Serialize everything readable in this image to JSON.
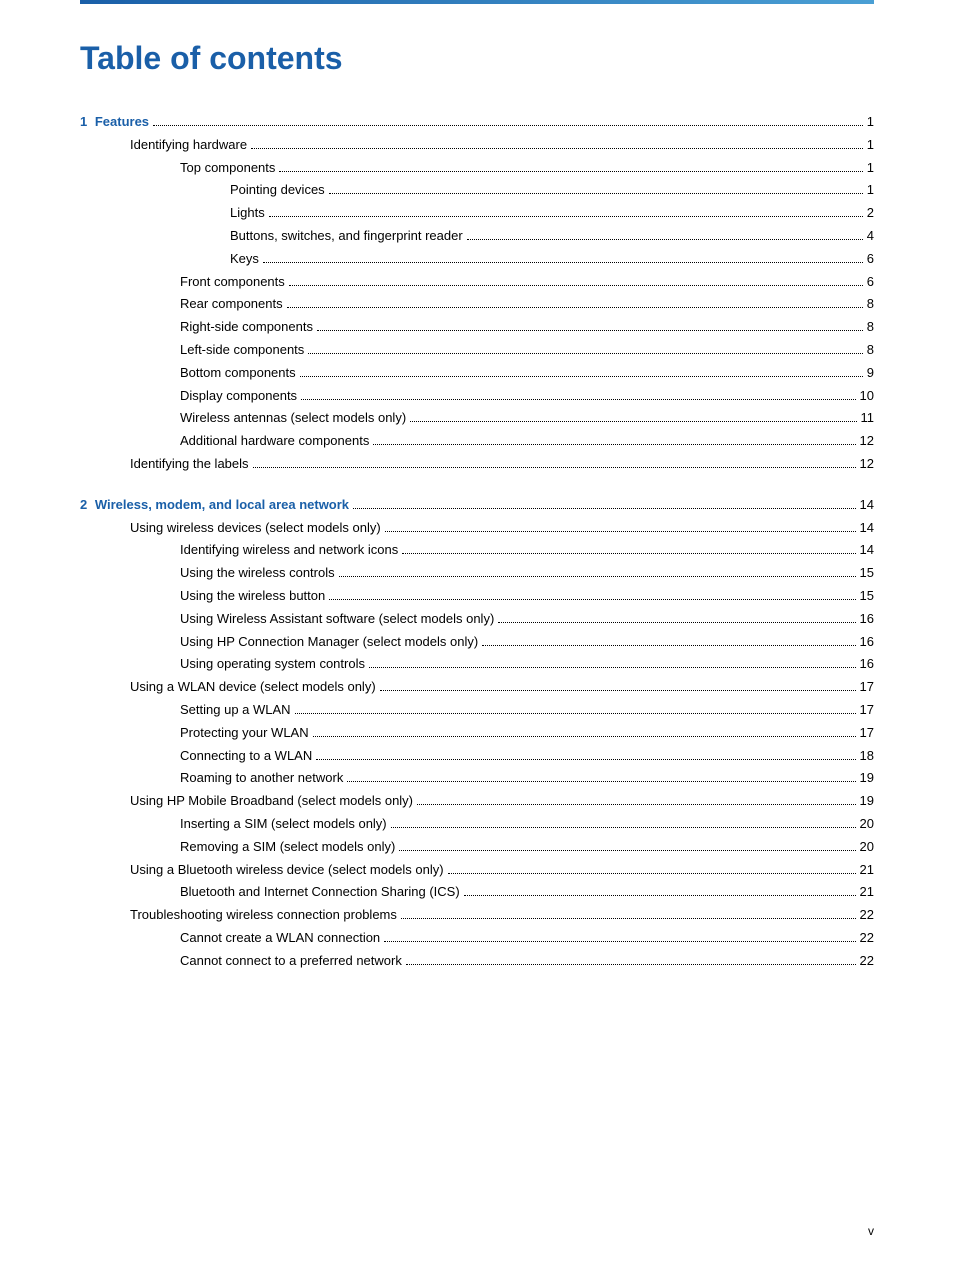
{
  "header": {
    "title": "Table of contents"
  },
  "footer": {
    "page": "v"
  },
  "toc": [
    {
      "level": 1,
      "number": "1",
      "text": "Features",
      "page": "1",
      "children": [
        {
          "level": 2,
          "text": "Identifying hardware",
          "page": "1",
          "children": [
            {
              "level": 3,
              "text": "Top components",
              "page": "1",
              "children": [
                {
                  "level": 4,
                  "text": "Pointing devices",
                  "page": "1"
                },
                {
                  "level": 4,
                  "text": "Lights",
                  "page": "2"
                },
                {
                  "level": 4,
                  "text": "Buttons, switches, and fingerprint reader",
                  "page": "4"
                },
                {
                  "level": 4,
                  "text": "Keys",
                  "page": "6"
                }
              ]
            },
            {
              "level": 3,
              "text": "Front components",
              "page": "6",
              "children": []
            },
            {
              "level": 3,
              "text": "Rear components",
              "page": "8",
              "children": []
            },
            {
              "level": 3,
              "text": "Right-side components",
              "page": "8",
              "children": []
            },
            {
              "level": 3,
              "text": "Left-side components",
              "page": "8",
              "children": []
            },
            {
              "level": 3,
              "text": "Bottom components",
              "page": "9",
              "children": []
            },
            {
              "level": 3,
              "text": "Display components",
              "page": "10",
              "children": []
            },
            {
              "level": 3,
              "text": "Wireless antennas (select models only)",
              "page": "11",
              "children": []
            },
            {
              "level": 3,
              "text": "Additional hardware components",
              "page": "12",
              "children": []
            }
          ]
        },
        {
          "level": 2,
          "text": "Identifying the labels",
          "page": "12",
          "children": []
        }
      ]
    },
    {
      "level": 1,
      "number": "2",
      "text": "Wireless, modem, and local area network",
      "page": "14",
      "children": [
        {
          "level": 2,
          "text": "Using wireless devices (select models only)",
          "page": "14",
          "children": [
            {
              "level": 3,
              "text": "Identifying wireless and network icons",
              "page": "14",
              "children": []
            },
            {
              "level": 3,
              "text": "Using the wireless controls",
              "page": "15",
              "children": []
            },
            {
              "level": 3,
              "text": "Using the wireless button",
              "page": "15",
              "children": []
            },
            {
              "level": 3,
              "text": "Using Wireless Assistant software (select models only)",
              "page": "16",
              "children": []
            },
            {
              "level": 3,
              "text": "Using HP Connection Manager (select models only)",
              "page": "16",
              "children": []
            },
            {
              "level": 3,
              "text": "Using operating system controls",
              "page": "16",
              "children": []
            }
          ]
        },
        {
          "level": 2,
          "text": "Using a WLAN device (select models only)",
          "page": "17",
          "children": [
            {
              "level": 3,
              "text": "Setting up a WLAN",
              "page": "17",
              "children": []
            },
            {
              "level": 3,
              "text": "Protecting your WLAN",
              "page": "17",
              "children": []
            },
            {
              "level": 3,
              "text": "Connecting to a WLAN",
              "page": "18",
              "children": []
            },
            {
              "level": 3,
              "text": "Roaming to another network",
              "page": "19",
              "children": []
            }
          ]
        },
        {
          "level": 2,
          "text": "Using HP Mobile Broadband (select models only)",
          "page": "19",
          "children": [
            {
              "level": 3,
              "text": "Inserting a SIM (select models only)",
              "page": "20",
              "children": []
            },
            {
              "level": 3,
              "text": "Removing a SIM (select models only)",
              "page": "20",
              "children": []
            }
          ]
        },
        {
          "level": 2,
          "text": "Using a Bluetooth wireless device (select models only)",
          "page": "21",
          "children": [
            {
              "level": 3,
              "text": "Bluetooth and Internet Connection Sharing (ICS)",
              "page": "21",
              "children": []
            }
          ]
        },
        {
          "level": 2,
          "text": "Troubleshooting wireless connection problems",
          "page": "22",
          "children": [
            {
              "level": 3,
              "text": "Cannot create a WLAN connection",
              "page": "22",
              "children": []
            },
            {
              "level": 3,
              "text": "Cannot connect to a preferred network",
              "page": "22",
              "children": []
            }
          ]
        }
      ]
    }
  ]
}
